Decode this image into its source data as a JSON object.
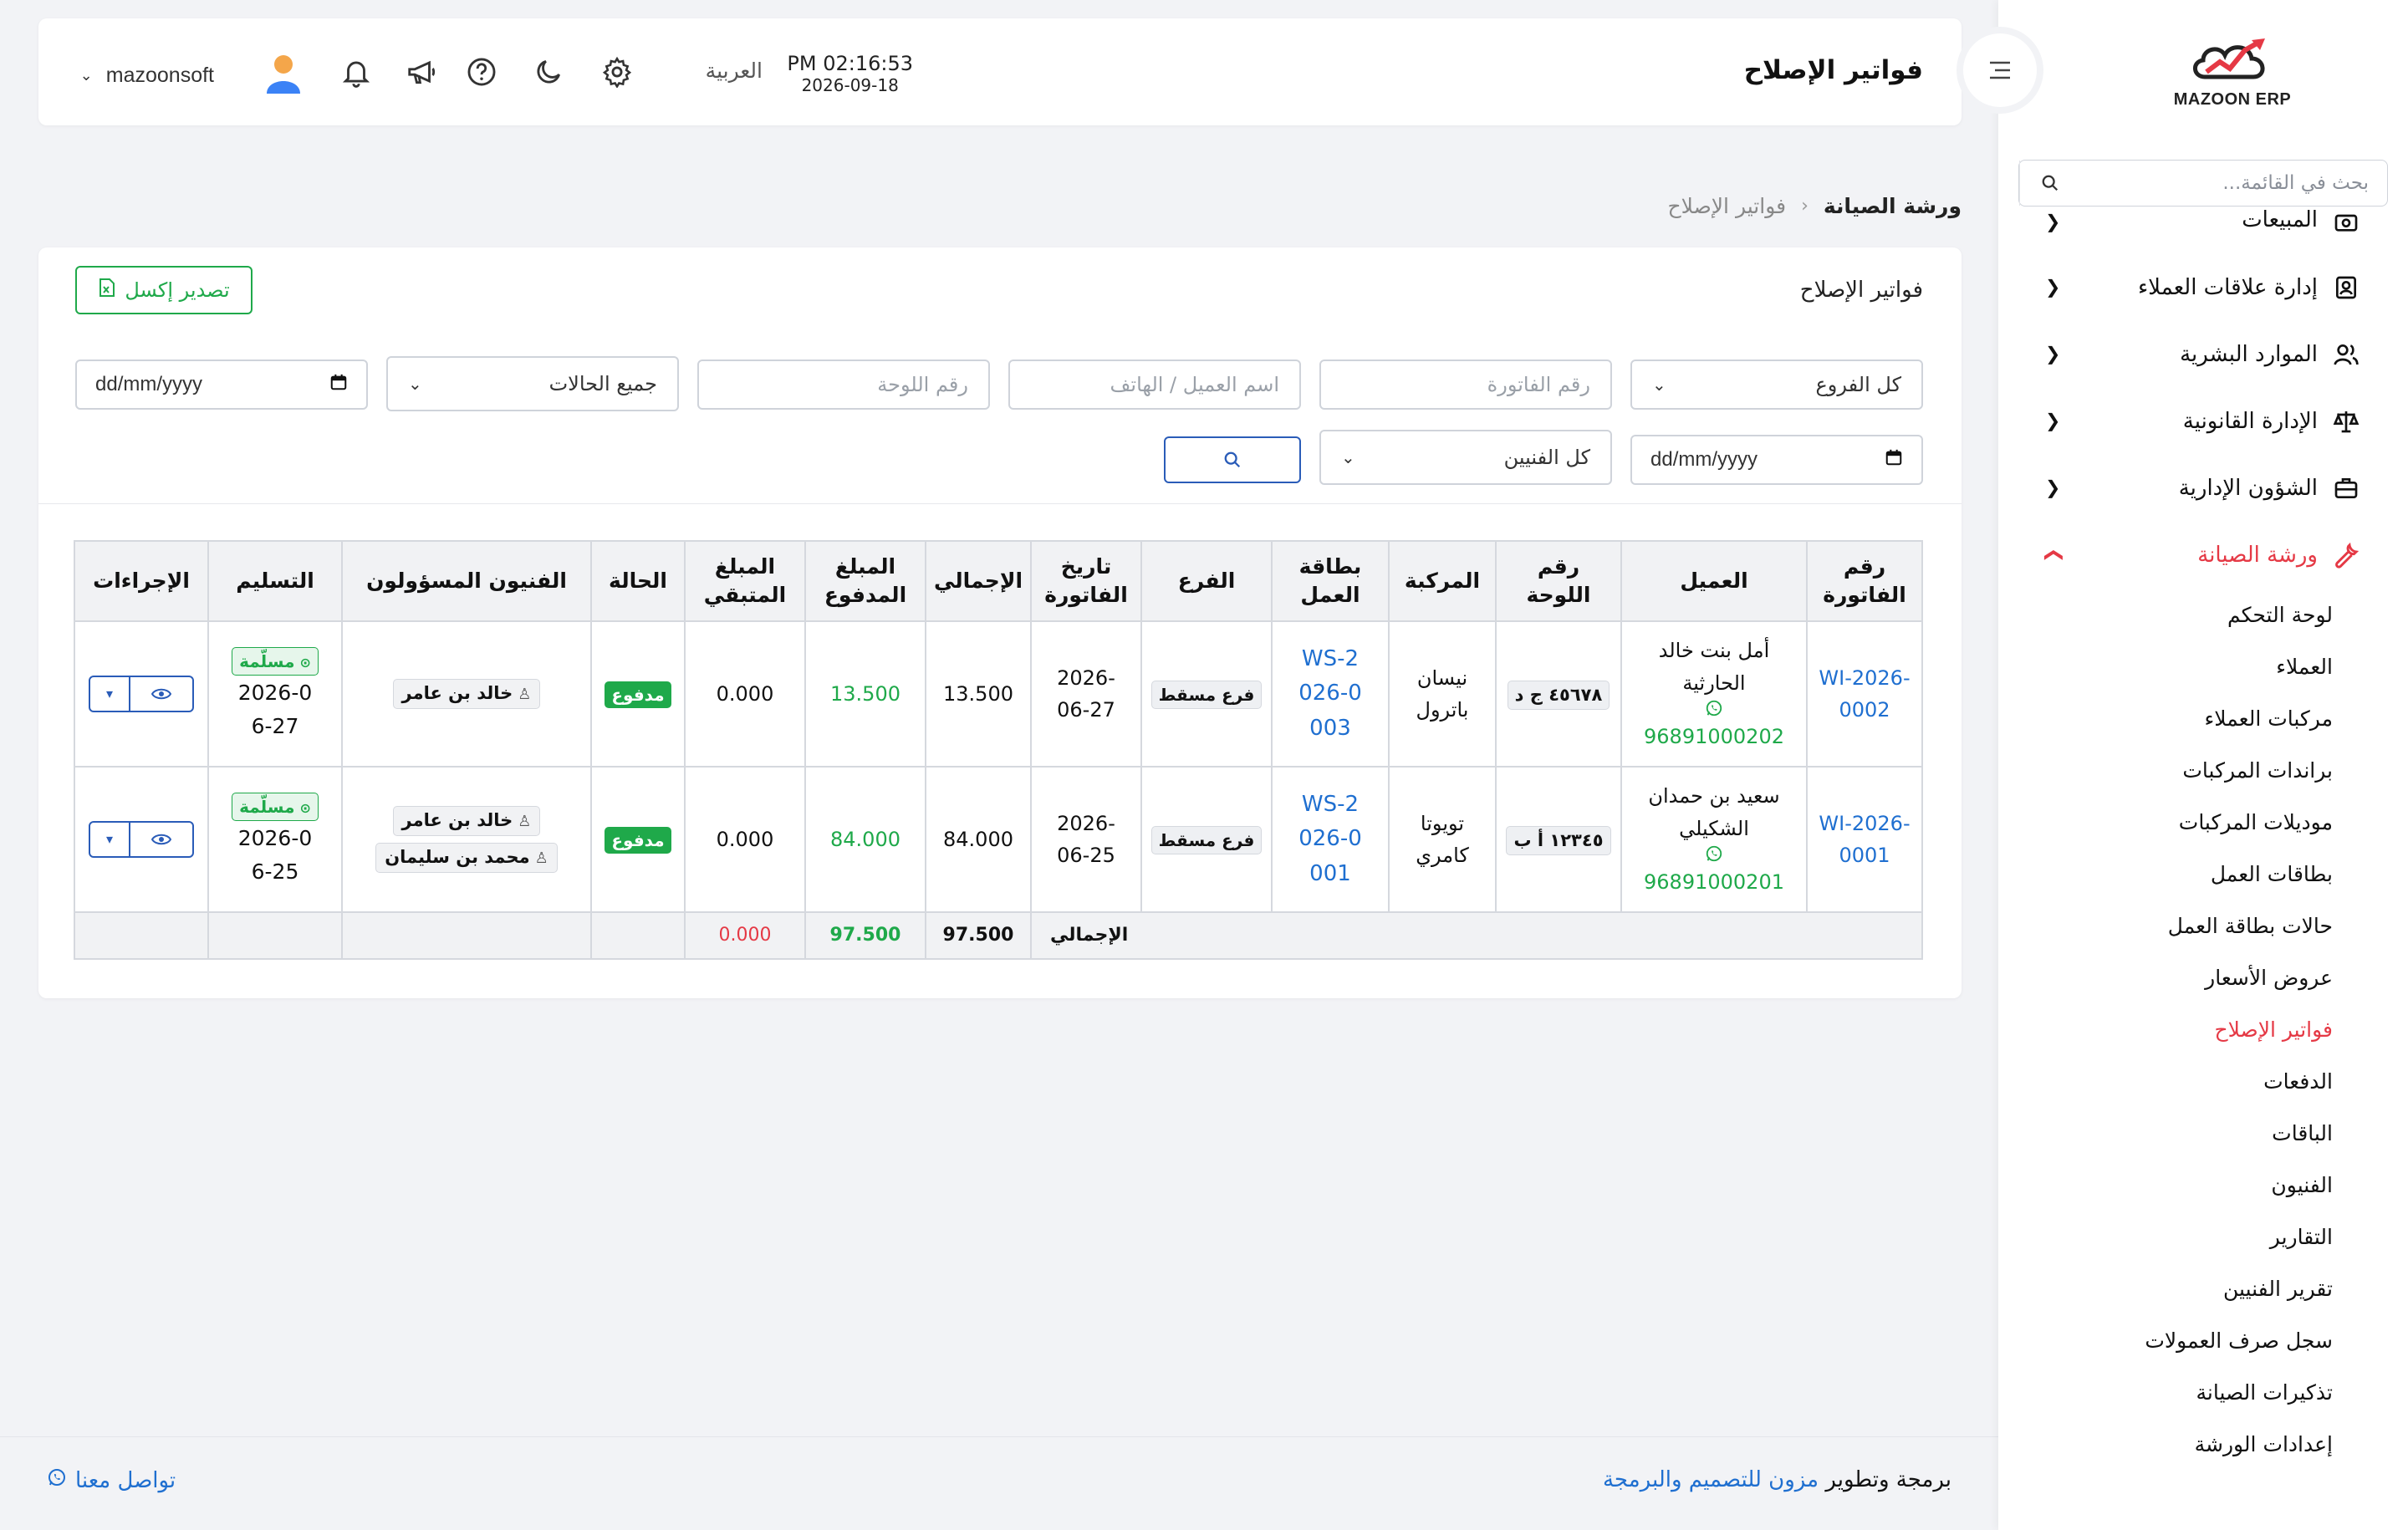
{
  "app": {
    "logo_text": "MAZOON ERP",
    "accent_color": "#e53945",
    "success_color": "#1fa94a",
    "link_color": "#1f6fd0"
  },
  "sidebar": {
    "search_placeholder": "بحث في القائمة...",
    "items": [
      {
        "label": "المبيعات",
        "icon": "cash-register-icon"
      },
      {
        "label": "إدارة علاقات العملاء",
        "icon": "contacts-icon"
      },
      {
        "label": "الموارد البشرية",
        "icon": "users-icon"
      },
      {
        "label": "الإدارة القانونية",
        "icon": "scale-icon"
      },
      {
        "label": "الشؤون الإدارية",
        "icon": "briefcase-icon"
      },
      {
        "label": "ورشة الصيانة",
        "icon": "wrench-icon",
        "active": true
      }
    ],
    "sub_items": [
      "لوحة التحكم",
      "العملاء",
      "مركبات العملاء",
      "براندات المركبات",
      "موديلات المركبات",
      "بطاقات العمل",
      "حالات بطاقة العمل",
      "عروض الأسعار",
      "فواتير الإصلاح",
      "الدفعات",
      "الباقات",
      "الفنيون",
      "التقارير",
      "تقرير الفنيين",
      "سجل صرف العمولات",
      "تذكيرات الصيانة",
      "إعدادات الورشة"
    ],
    "active_sub_index": 8
  },
  "header": {
    "title": "فواتير الإصلاح",
    "time": "PM 02:16:53",
    "date": "2026-09-18",
    "language": "العربية",
    "username": "mazoonsoft"
  },
  "breadcrumb": {
    "parent": "ورشة الصيانة",
    "current": "فواتير الإصلاح"
  },
  "card": {
    "title": "فواتير الإصلاح",
    "export_label": "تصدير إكسل",
    "filters": {
      "branch": "كل الفروع",
      "invoice_placeholder": "رقم الفاتورة",
      "customer_placeholder": "اسم العميل / الهاتف",
      "plate_placeholder": "رقم اللوحة",
      "status": "جميع الحالات",
      "date_placeholder": "dd/mm/yyyy",
      "date2_placeholder": "dd/mm/yyyy",
      "technicians": "كل الفنيين"
    }
  },
  "table": {
    "headers": {
      "invoice_no": "رقم الفاتورة",
      "customer": "العميل",
      "plate": "رقم اللوحة",
      "vehicle": "المركبة",
      "job_card": "بطاقة العمل",
      "branch": "الفرع",
      "invoice_date": "تاريخ الفاتورة",
      "total": "الإجمالي",
      "paid": "المبلغ المدفوع",
      "remaining": "المبلغ المتبقي",
      "status": "الحالة",
      "technicians": "الفنيون المسؤولون",
      "delivery": "التسليم",
      "actions": "الإجراءات"
    },
    "rows": [
      {
        "invoice_no": "WI-2026-0002",
        "customer_name": "أمل بنت خالد الحارثية",
        "customer_phone": "96891000202",
        "plate": "٤٥٦٧٨ ج د",
        "vehicle": "نيسان باترول",
        "job_card": "WS-2026-0003",
        "branch": "فرع مسقط",
        "invoice_date": "2026-06-27",
        "total": "13.500",
        "paid": "13.500",
        "remaining": "0.000",
        "status": "مدفوع",
        "technicians": [
          "خالد بن عامر"
        ],
        "delivery_status": "مسلّمة",
        "delivery_date": "2026-06-27"
      },
      {
        "invoice_no": "WI-2026-0001",
        "customer_name": "سعيد بن حمدان الشكيلي",
        "customer_phone": "96891000201",
        "plate": "١٢٣٤٥ أ ب",
        "vehicle": "تويوتا كامري",
        "job_card": "WS-2026-0001",
        "branch": "فرع مسقط",
        "invoice_date": "2026-06-25",
        "total": "84.000",
        "paid": "84.000",
        "remaining": "0.000",
        "status": "مدفوع",
        "technicians": [
          "خالد بن عامر",
          "محمد بن سليمان"
        ],
        "delivery_status": "مسلّمة",
        "delivery_date": "2026-06-25"
      }
    ],
    "totals": {
      "label": "الإجمالي",
      "total": "97.500",
      "paid": "97.500",
      "remaining": "0.000"
    }
  },
  "footer": {
    "credit_prefix": "برمجة وتطوير",
    "credit_brand": "مزون للتصميم والبرمجة",
    "contact": "تواصل معنا"
  }
}
